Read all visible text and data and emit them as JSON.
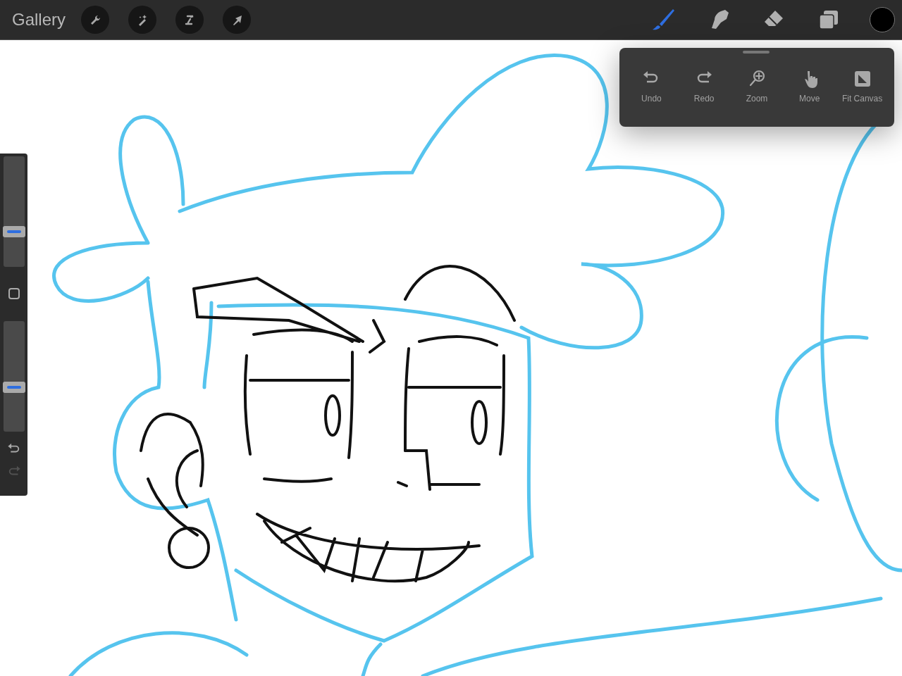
{
  "top_bar": {
    "gallery": "Gallery",
    "left_tools": [
      {
        "kind": "wrench"
      },
      {
        "kind": "wand"
      },
      {
        "kind": "select"
      },
      {
        "kind": "arrow"
      }
    ],
    "right_tools": [
      {
        "kind": "brush",
        "selected": true
      },
      {
        "kind": "smudge",
        "selected": false
      },
      {
        "kind": "eraser",
        "selected": false
      },
      {
        "kind": "layers",
        "selected": false
      }
    ]
  },
  "sidebar": {
    "size_slider": {
      "level": 0.3
    },
    "opacity_slider": {
      "level": 0.39
    },
    "undo": {
      "disabled": false
    },
    "redo": {
      "disabled": true
    }
  },
  "gesture_panel": {
    "items": [
      {
        "kind": "undo",
        "label": "Undo"
      },
      {
        "kind": "redo",
        "label": "Redo"
      },
      {
        "kind": "zoom",
        "label": "Zoom"
      },
      {
        "kind": "move",
        "label": "Move"
      },
      {
        "kind": "fit",
        "label": "Fit Canvas"
      }
    ]
  }
}
